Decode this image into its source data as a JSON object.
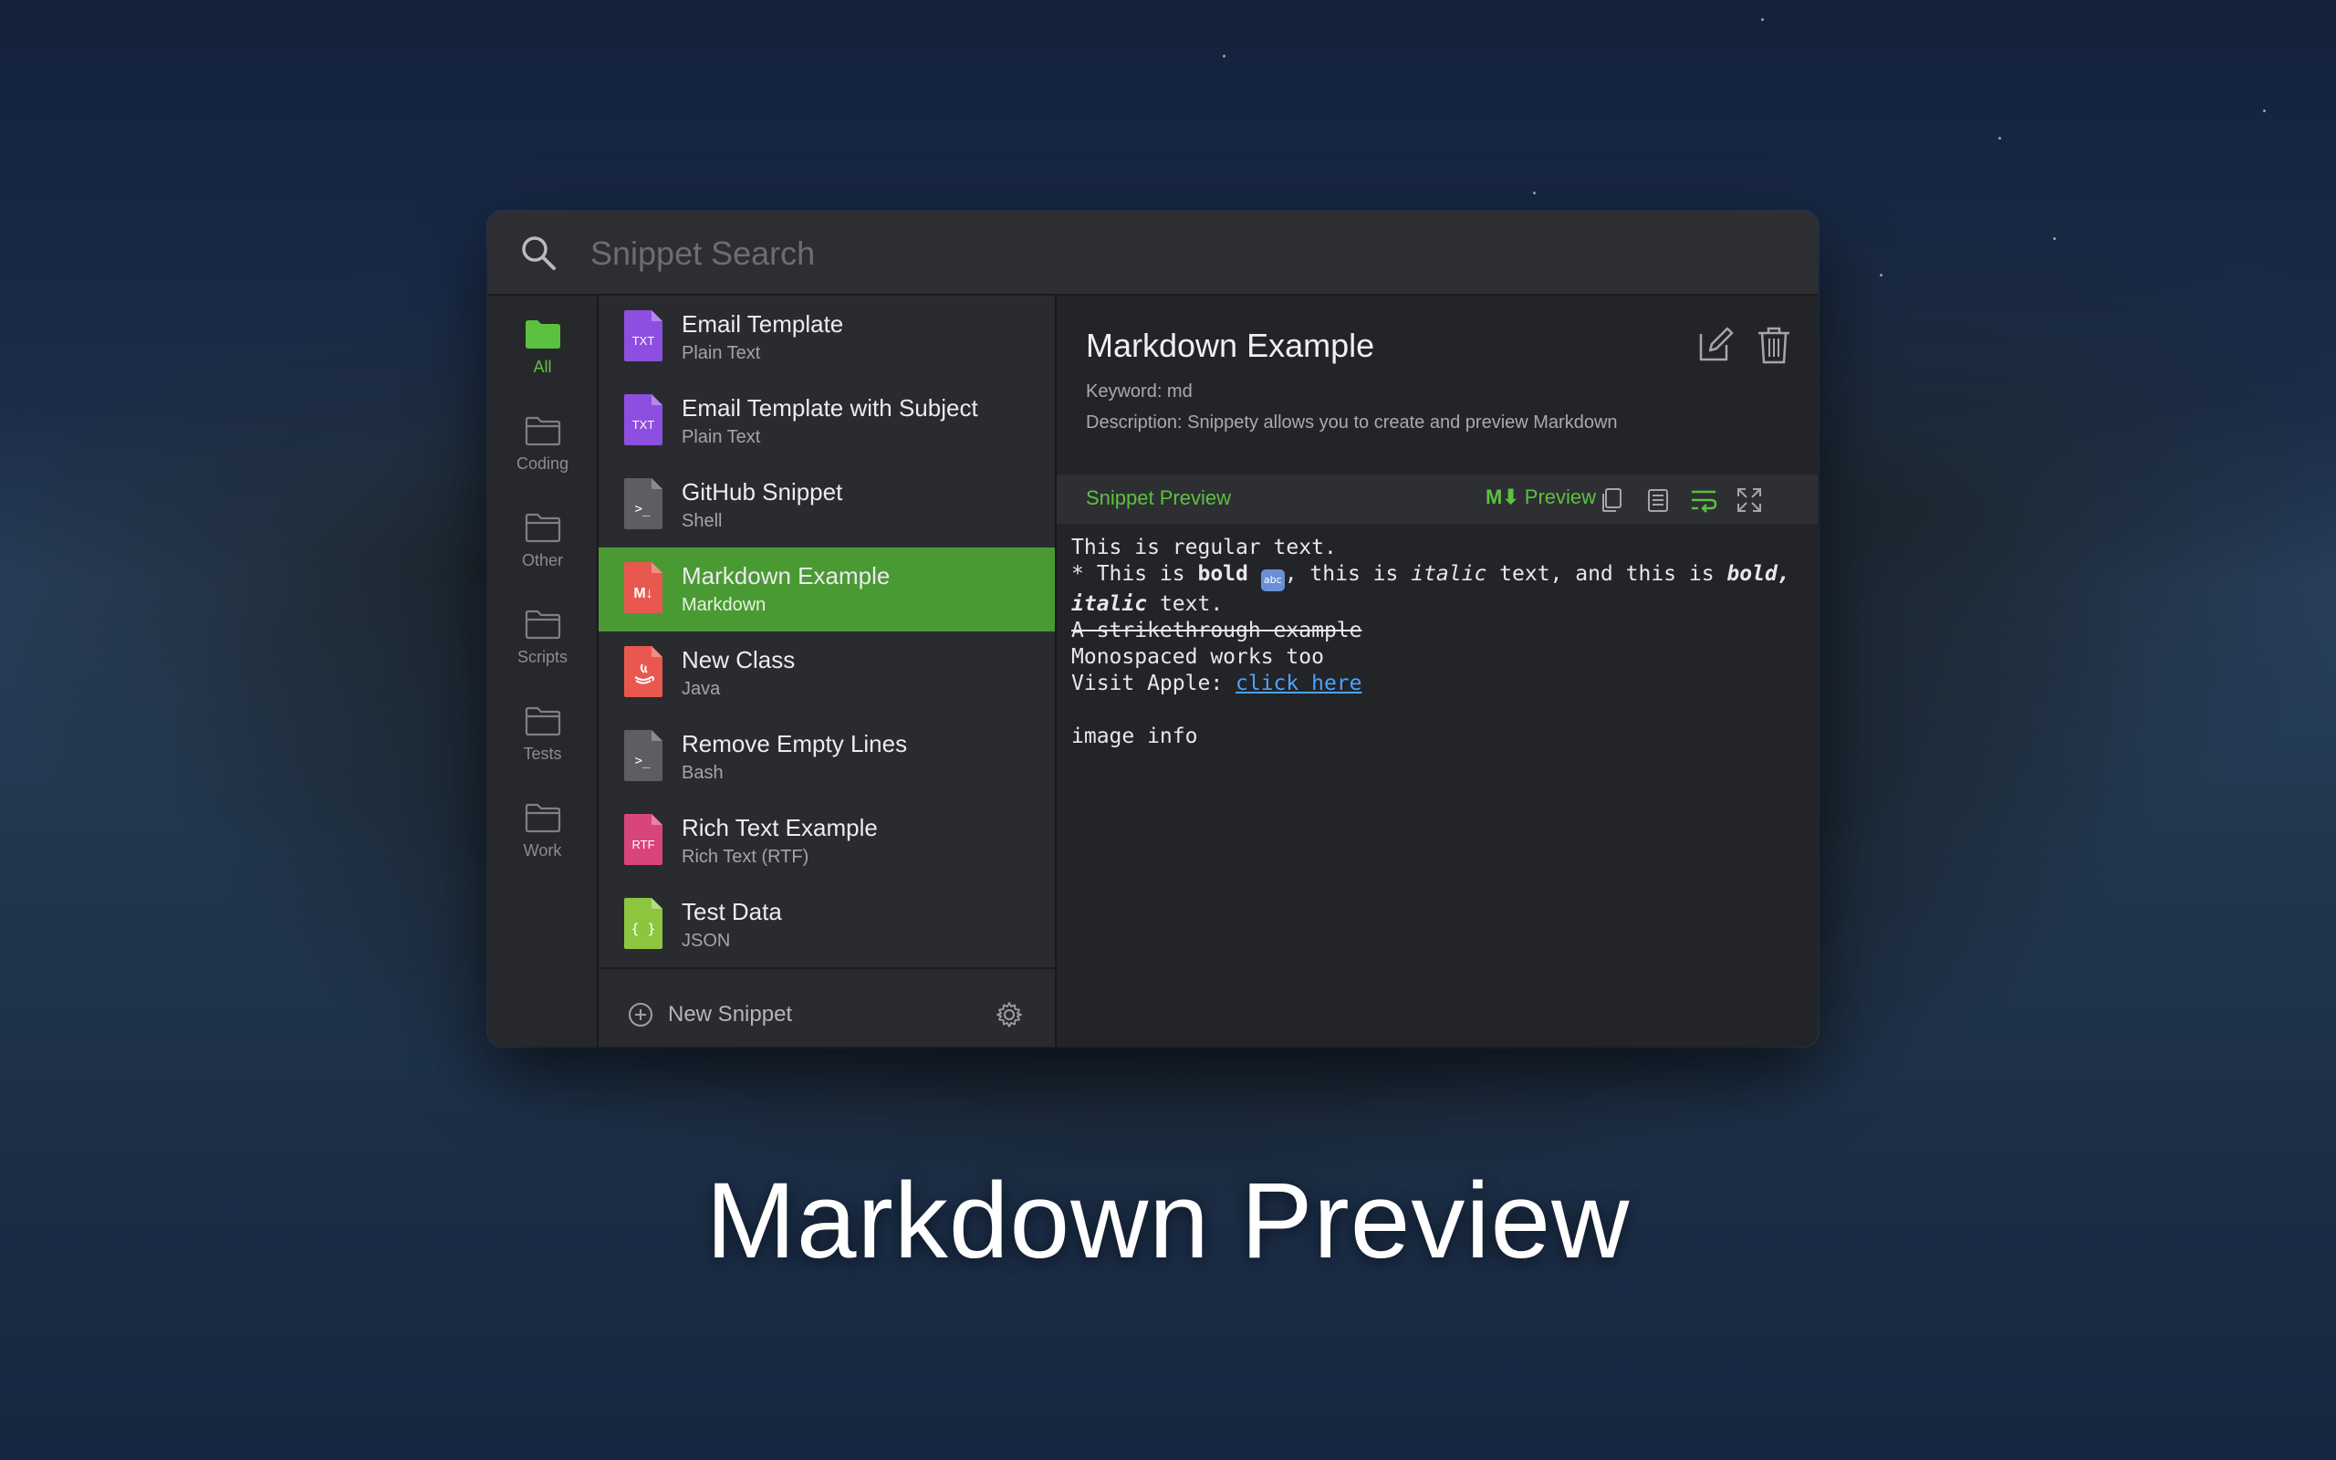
{
  "wallpaper": {
    "caption": "Markdown Preview"
  },
  "search": {
    "placeholder": "Snippet Search",
    "value": ""
  },
  "sidebar": {
    "folders": [
      {
        "label": "All",
        "active": true
      },
      {
        "label": "Coding"
      },
      {
        "label": "Other"
      },
      {
        "label": "Scripts"
      },
      {
        "label": "Tests"
      },
      {
        "label": "Work"
      }
    ]
  },
  "snippets": [
    {
      "title": "Email Template",
      "type": "Plain Text",
      "icon": "txt-file-icon",
      "badge": "TXT",
      "color": "#8d4fe0"
    },
    {
      "title": "Email Template with Subject",
      "type": "Plain Text",
      "icon": "txt-file-icon",
      "badge": "TXT",
      "color": "#8d4fe0"
    },
    {
      "title": "GitHub Snippet",
      "type": "Shell",
      "icon": "terminal-file-icon",
      "badge": ">_",
      "color": "#5d5e63"
    },
    {
      "title": "Markdown Example",
      "type": "Markdown",
      "icon": "markdown-file-icon",
      "badge": "M↓",
      "color": "#e8584f",
      "selected": true
    },
    {
      "title": "New Class",
      "type": "Java",
      "icon": "java-file-icon",
      "badge": "☕",
      "color": "#e8584f"
    },
    {
      "title": "Remove Empty Lines",
      "type": "Bash",
      "icon": "terminal-file-icon",
      "badge": ">_",
      "color": "#5d5e63"
    },
    {
      "title": "Rich Text Example",
      "type": "Rich Text (RTF)",
      "icon": "rtf-file-icon",
      "badge": "RTF",
      "color": "#d9457a"
    },
    {
      "title": "Test Data",
      "type": "JSON",
      "icon": "json-file-icon",
      "badge": "{ }",
      "color": "#8cc63f"
    }
  ],
  "footer": {
    "new_snippet_label": "New Snippet"
  },
  "detail": {
    "title": "Markdown Example",
    "keyword": "Keyword: md",
    "description": "Description: Snippety allows you to create and preview Markdown",
    "preview_label": "Snippet Preview",
    "md_badge": "M⬇",
    "preview_toggle": "Preview"
  },
  "preview": {
    "line1": "This is regular text.",
    "line2_a": "* This is ",
    "line2_bold": "bold",
    "line2_b": ", this is ",
    "line2_italic": "italic",
    "line2_c": " text, and this is ",
    "line2_bolditalic": "bold,",
    "line3_bolditalic": "italic",
    "line3_rest": " text.",
    "line4_strike": "A strikethrough example",
    "line5": "Monospaced works too",
    "line6_prefix": "Visit Apple: ",
    "line6_link": "click here",
    "line8": "image info"
  },
  "colors": {
    "accent": "#5cc13f",
    "selected_row": "#4a9a34",
    "link": "#4aa3ff"
  }
}
